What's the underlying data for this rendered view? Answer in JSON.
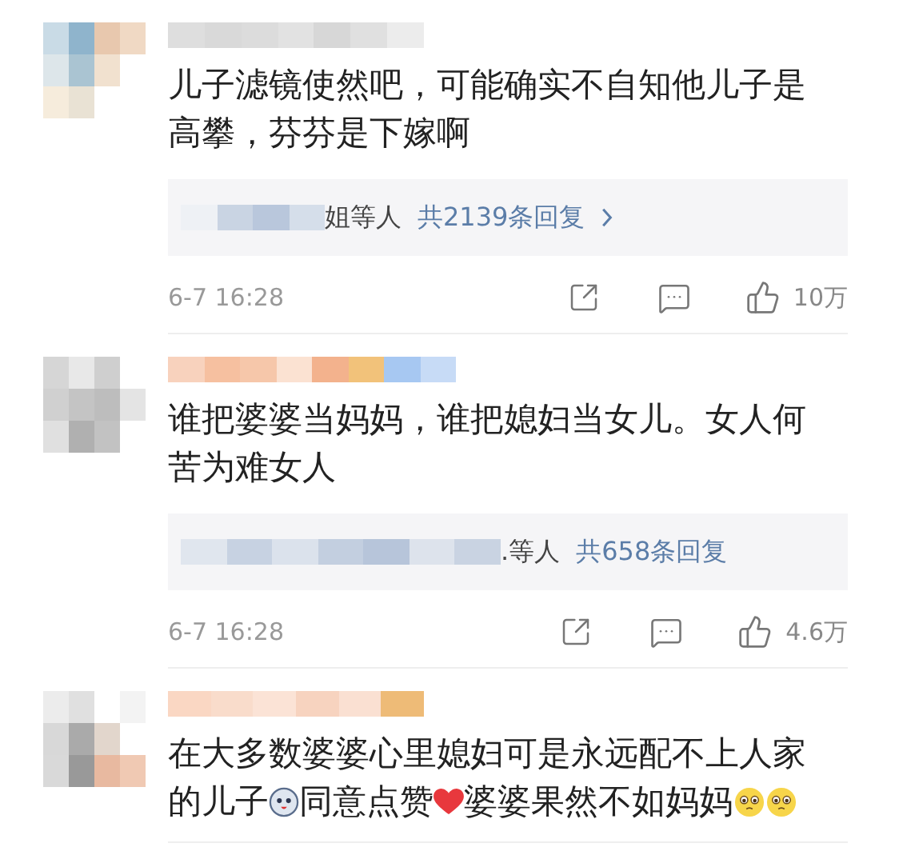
{
  "comments": [
    {
      "content": [
        {
          "kind": "text",
          "text": "儿子滤镜使然吧，可能确实不自知他儿子是高攀，芬芬是下嫁啊"
        }
      ],
      "replies": {
        "names_suffix": "姐等人",
        "count_link": "共2139条回复",
        "has_arrow": true
      },
      "time": "6-7 16:28",
      "likes": "10万"
    },
    {
      "content": [
        {
          "kind": "text",
          "text": "谁把婆婆当妈妈，谁把媳妇当女儿。女人何苦为难女人"
        }
      ],
      "replies": {
        "names_suffix": ".等人",
        "count_link": "共658条回复",
        "has_arrow": false
      },
      "time": "6-7 16:28",
      "likes": "4.6万"
    },
    {
      "content": [
        {
          "kind": "text",
          "text": "在大多数婆婆心里媳妇可是永远配不上人家的儿子"
        },
        {
          "kind": "husky"
        },
        {
          "kind": "text",
          "text": "同意点赞"
        },
        {
          "kind": "heart"
        },
        {
          "kind": "text",
          "text": "婆婆果然不如妈妈"
        },
        {
          "kind": "pleading"
        },
        {
          "kind": "pleading"
        }
      ]
    }
  ]
}
